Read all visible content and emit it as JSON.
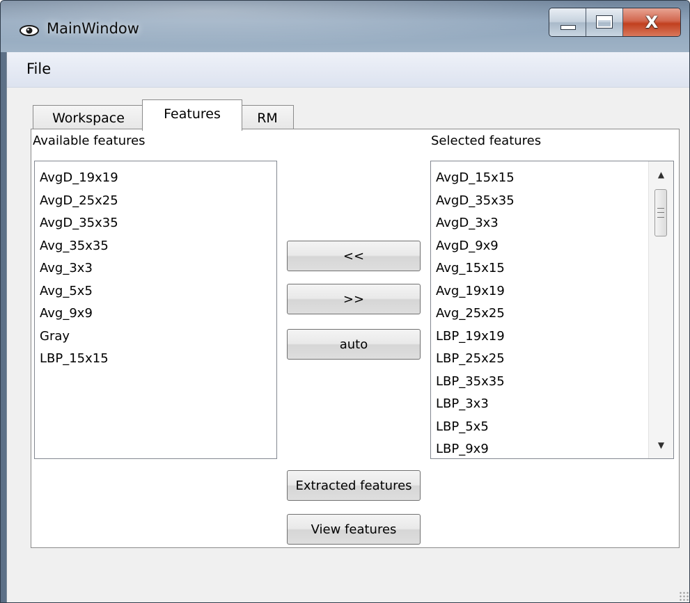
{
  "window": {
    "title": "MainWindow",
    "title_icon": "eye-icon",
    "controls": {
      "minimize": "minimize-icon",
      "maximize": "maximize-icon",
      "close_glyph": "X"
    }
  },
  "menubar": {
    "items": [
      {
        "label": "File"
      }
    ]
  },
  "tabs": [
    {
      "label": "Workspace",
      "active": false
    },
    {
      "label": "Features",
      "active": true
    },
    {
      "label": "RM",
      "active": false
    }
  ],
  "features_tab": {
    "available_label": "Available features",
    "selected_label": "Selected features",
    "available": [
      "AvgD_19x19",
      "AvgD_25x25",
      "AvgD_35x35",
      "Avg_35x35",
      "Avg_3x3",
      "Avg_5x5",
      "Avg_9x9",
      "Gray",
      "LBP_15x15"
    ],
    "selected": [
      "AvgD_15x15",
      "AvgD_35x35",
      "AvgD_3x3",
      "AvgD_9x9",
      "Avg_15x15",
      "Avg_19x19",
      "Avg_25x25",
      "LBP_19x19",
      "LBP_25x25",
      "LBP_35x35",
      "LBP_3x3",
      "LBP_5x5",
      "LBP_9x9"
    ],
    "buttons": {
      "add_all": "<<",
      "remove": ">>",
      "auto": "auto",
      "extracted": "Extracted features",
      "view": "View features"
    }
  }
}
